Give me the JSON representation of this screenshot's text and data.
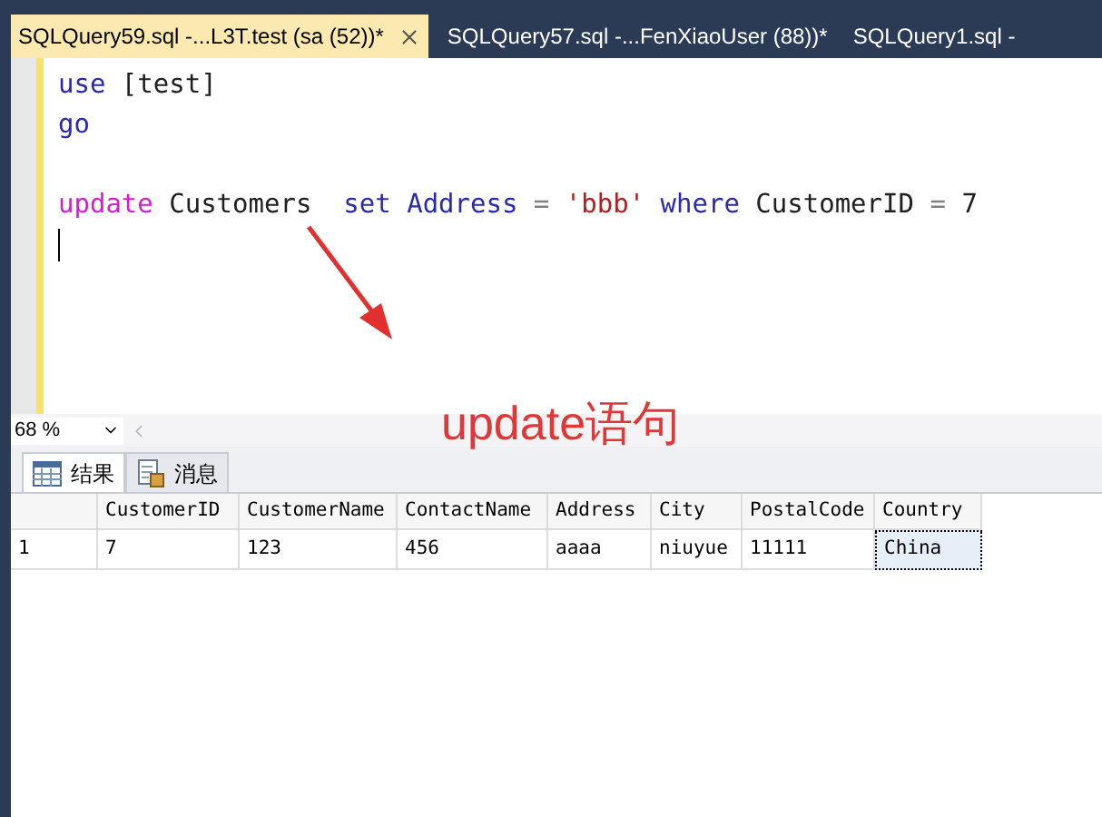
{
  "tabs": [
    {
      "label": "SQLQuery59.sql -...L3T.test (sa (52))*",
      "selected": true
    },
    {
      "label": "SQLQuery57.sql -...FenXiaoUser (88))*",
      "selected": false
    },
    {
      "label": "SQLQuery1.sql -",
      "selected": false
    }
  ],
  "editor": {
    "lines": [
      {
        "kind": "code",
        "tokens": [
          {
            "text": "use",
            "kind": "keyword"
          },
          {
            "text": " [test]",
            "kind": "plain"
          }
        ]
      },
      {
        "kind": "code",
        "tokens": [
          {
            "text": "go",
            "kind": "keyword"
          }
        ]
      },
      {
        "kind": "blank"
      },
      {
        "kind": "code",
        "tokens": [
          {
            "text": "update",
            "kind": "function"
          },
          {
            "text": " Customers  ",
            "kind": "plain"
          },
          {
            "text": "set",
            "kind": "keyword"
          },
          {
            "text": " Address",
            "kind": "keyword"
          },
          {
            "text": " = ",
            "kind": "operator"
          },
          {
            "text": "'bbb'",
            "kind": "string"
          },
          {
            "text": " where",
            "kind": "keyword"
          },
          {
            "text": " CustomerID",
            "kind": "plain"
          },
          {
            "text": " = ",
            "kind": "operator"
          },
          {
            "text": "7",
            "kind": "plain"
          }
        ]
      },
      {
        "kind": "cursor"
      }
    ]
  },
  "annotation": {
    "text": "update语句"
  },
  "zoom": {
    "value": "68 %"
  },
  "result_tabs": [
    {
      "label": "结果",
      "kind": "grid",
      "selected": true
    },
    {
      "label": "消息",
      "kind": "messages",
      "selected": false
    }
  ],
  "table": {
    "columns": [
      "",
      "CustomerID",
      "CustomerName",
      "ContactName",
      "Address",
      "City",
      "PostalCode",
      "Country"
    ],
    "rows": [
      {
        "cells": [
          {
            "text": "1",
            "selected": false
          },
          {
            "text": "7",
            "selected": false
          },
          {
            "text": "123",
            "selected": false
          },
          {
            "text": "456",
            "selected": false
          },
          {
            "text": "aaaa",
            "selected": false
          },
          {
            "text": "niuyue",
            "selected": false
          },
          {
            "text": "11111",
            "selected": false
          },
          {
            "text": "China",
            "selected": true
          }
        ]
      }
    ]
  }
}
